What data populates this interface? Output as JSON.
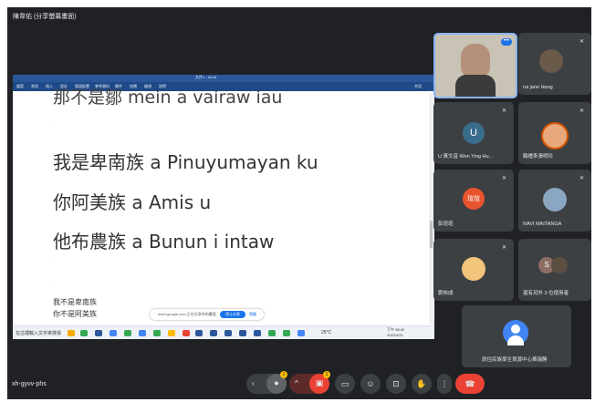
{
  "presenter_label": "陳韋佑 (分享螢幕畫面)",
  "word": {
    "title": "文件1 - Word",
    "ribbon_tabs": [
      "檔案",
      "常用",
      "插入",
      "設計",
      "版面配置",
      "參考資料",
      "郵件",
      "校閱",
      "檢視",
      "說明"
    ],
    "share_label": "共用"
  },
  "document": {
    "lines": [
      "那不是鄒 mein a vairaw iau",
      "我是卑南族  a Pinuyumayan ku",
      "你阿美族 a Amis u",
      "他布農族 a Bunun i intaw"
    ],
    "small_lines": [
      "我不是卑南族",
      "你不是阿美族"
    ]
  },
  "share_pill": {
    "text": "meet.google.com 正在分享你的畫面",
    "stop": "停止分享",
    "hide": "隱藏"
  },
  "taskbar": {
    "search": "在這裡輸入文字來搜尋",
    "time": "下午 08:40",
    "date": "2022/4/21",
    "temp": "25°C"
  },
  "participants": [
    {
      "name": "",
      "type": "video"
    },
    {
      "name": "rui jane Hang",
      "type": "photo"
    },
    {
      "name": "U 黃文音 Wen Ying Hu...",
      "initial": "U",
      "color": "#3a6d8c"
    },
    {
      "name": "饒禮系張明珍",
      "type": "photo"
    },
    {
      "name": "彭瑄瑄",
      "initial": "瑄瑄",
      "color": "#e8542f"
    },
    {
      "name": "NAVI MAITANGA",
      "type": "photo"
    },
    {
      "name": "劉祐成",
      "type": "photo"
    },
    {
      "name": "還有另外 3 位使用者",
      "initial": "S",
      "color": "#8d6e63"
    }
  ],
  "self_tile": {
    "name": "原住民族學生資源中心黃瑞勝"
  },
  "meeting_code": "xh-gyvv-phs",
  "badges": {
    "mic": "1",
    "cam": "1"
  },
  "colors": {
    "background": "#202124",
    "tile": "#3c4043",
    "end_call": "#ea4335"
  }
}
